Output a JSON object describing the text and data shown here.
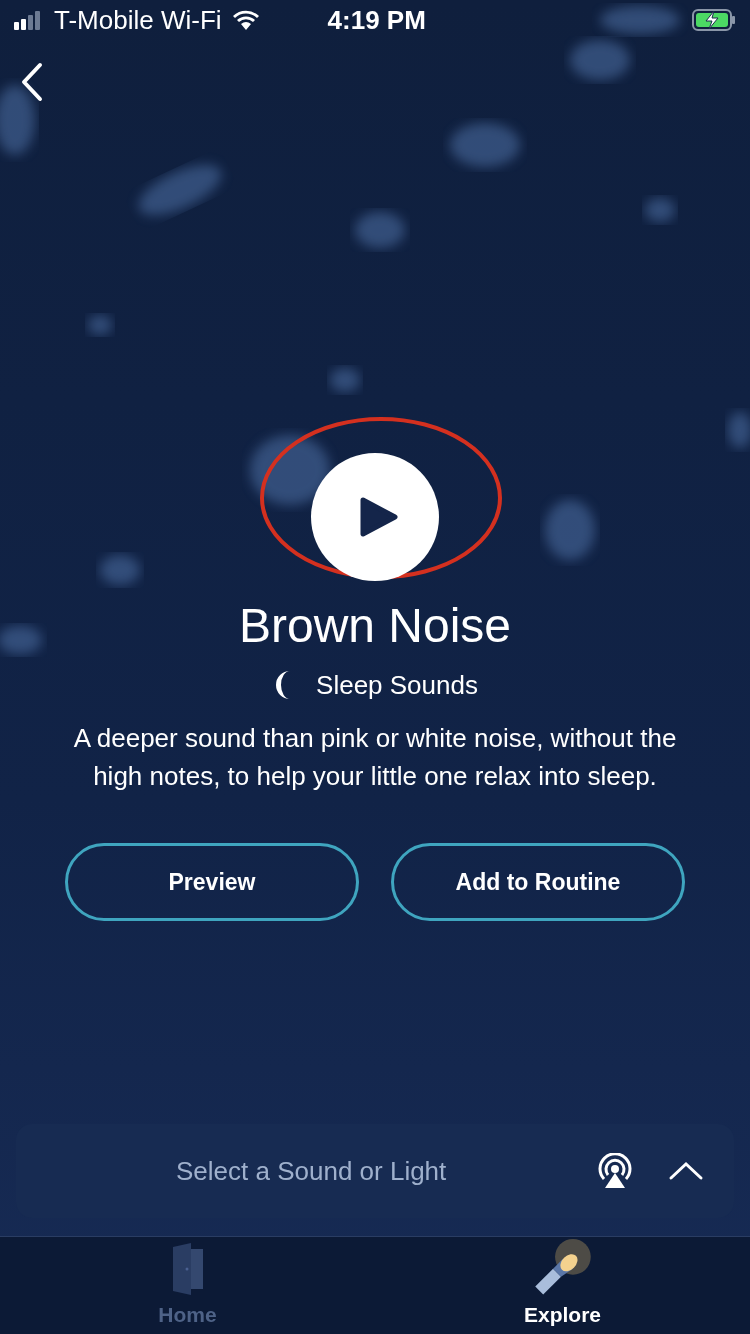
{
  "status_bar": {
    "carrier": "T-Mobile Wi-Fi",
    "time": "4:19 PM"
  },
  "sound": {
    "title": "Brown Noise",
    "category": "Sleep Sounds",
    "description": "A deeper sound than pink or white noise, without the high notes, to help your little one relax into sleep."
  },
  "actions": [
    "Preview",
    "Add to Routine"
  ],
  "player": {
    "placeholder": "Select a Sound or Light"
  },
  "tabs": [
    {
      "label": "Home",
      "kind": "home",
      "selected": false
    },
    {
      "label": "Explore",
      "kind": "explore",
      "selected": true
    }
  ]
}
